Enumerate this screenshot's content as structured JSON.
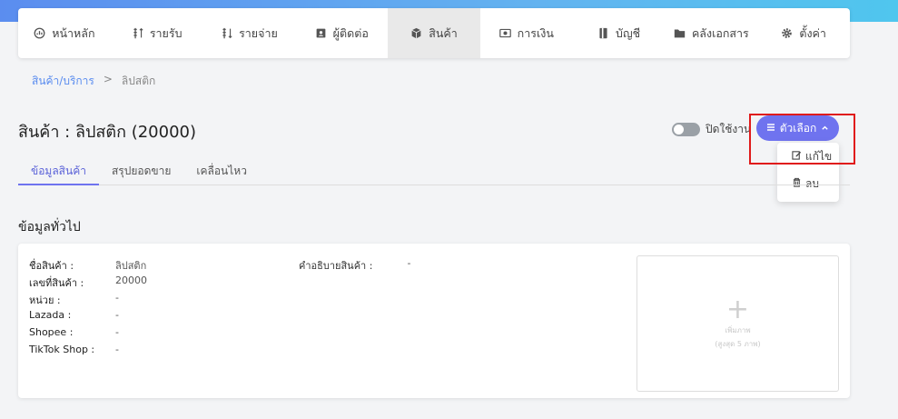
{
  "nav": {
    "items": [
      {
        "label": "หน้าหลัก",
        "icon": "dashboard-icon"
      },
      {
        "label": "รายรับ",
        "icon": "income-icon"
      },
      {
        "label": "รายจ่าย",
        "icon": "expense-icon"
      },
      {
        "label": "ผู้ติดต่อ",
        "icon": "contacts-icon"
      },
      {
        "label": "สินค้า",
        "icon": "box-icon"
      },
      {
        "label": "การเงิน",
        "icon": "money-icon"
      },
      {
        "label": "บัญชี",
        "icon": "book-icon"
      },
      {
        "label": "คลังเอกสาร",
        "icon": "folder-icon"
      },
      {
        "label": "ตั้งค่า",
        "icon": "gear-icon"
      }
    ],
    "active_index": 4
  },
  "breadcrumb": {
    "parent": "สินค้า/บริการ",
    "separator": ">",
    "current": "ลิปสติก"
  },
  "page": {
    "title": "สินค้า : ลิปสติก (20000)"
  },
  "toggle": {
    "label": "ปิดใช้งาน"
  },
  "options": {
    "label": "ตัวเลือก",
    "menu": [
      "แก้ไข",
      "ลบ"
    ]
  },
  "tabs": [
    "ข้อมูลสินค้า",
    "สรุปยอดขาย",
    "เคลื่อนไหว"
  ],
  "section": {
    "title": "ข้อมูลทั่วไป"
  },
  "info": {
    "rows": [
      {
        "label": "ชื่อสินค้า :",
        "value": "ลิปสติก"
      },
      {
        "label": "เลขที่สินค้า :",
        "value": "20000"
      },
      {
        "label": "หน่วย :",
        "value": "-"
      },
      {
        "label": "Lazada :",
        "value": "-"
      },
      {
        "label": "Shopee :",
        "value": "-"
      },
      {
        "label": "TikTok Shop :",
        "value": "-"
      }
    ],
    "description_label": "คำอธิบายสินค้า :",
    "description_value": "-"
  },
  "image_upload": {
    "line1": "เพิ่มภาพ",
    "line2": "(สูงสุด 5 ภาพ)"
  },
  "colors": {
    "accent": "#6f73ef",
    "highlight": "#e01b1b",
    "link": "#5b8def"
  }
}
